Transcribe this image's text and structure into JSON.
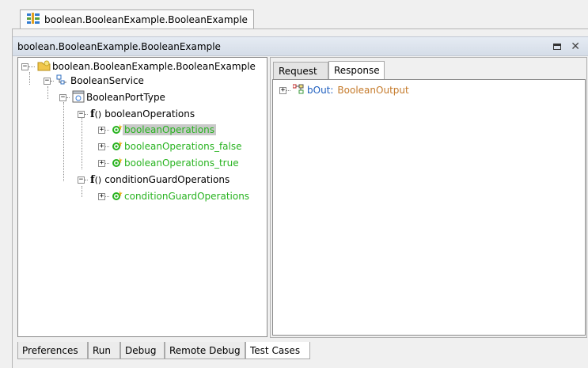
{
  "editor_tab": {
    "title": "boolean.BooleanExample.BooleanExample"
  },
  "window": {
    "title": "boolean.BooleanExample.BooleanExample"
  },
  "tree": {
    "root": "boolean.BooleanExample.BooleanExample",
    "service": "BooleanService",
    "port_type": "BooleanPortType",
    "groups": [
      {
        "name": "booleanOperations",
        "fx_label": "f",
        "fx_parens": "()",
        "operations": [
          "booleanOperations",
          "booleanOperations_false",
          "booleanOperations_true"
        ],
        "selected_index": 0
      },
      {
        "name": "conditionGuardOperations",
        "fx_label": "f",
        "fx_parens": "()",
        "operations": [
          "conditionGuardOperations"
        ]
      }
    ]
  },
  "right_tabs": [
    {
      "label": "Request",
      "active": false
    },
    {
      "label": "Response",
      "active": true
    }
  ],
  "response": {
    "field_name": "bOut:",
    "field_type": "BooleanOutput",
    "type_color": "#c57a2a",
    "name_color": "#1f5fbf"
  },
  "bottom_tabs": [
    {
      "label": "Preferences",
      "active": false
    },
    {
      "label": "Run",
      "active": false
    },
    {
      "label": "Debug",
      "active": false
    },
    {
      "label": "Remote Debug",
      "active": false
    },
    {
      "label": "Test Cases",
      "active": true
    }
  ],
  "colors": {
    "operation_green": "#27b31f",
    "title_bar": "#d9e1ec",
    "selection": "#c9c9c9"
  }
}
